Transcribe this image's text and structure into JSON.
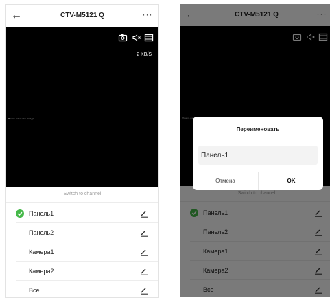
{
  "screen": {
    "back_icon": "arrow-left-icon",
    "title": "CTV-M5121 Q",
    "more_icon": "more-horizontal-icon",
    "more_glyph": "···",
    "video": {
      "icons": [
        "camera-icon",
        "speaker-mute-icon",
        "fullscreen-icon"
      ],
      "bitrate": "2 KB/S",
      "osd_text": "Панель с вызывну. вход пд"
    },
    "sheet": {
      "title": "Switch to channel",
      "channels": [
        {
          "label": "Панель1",
          "selected": true
        },
        {
          "label": "Панель2",
          "selected": false
        },
        {
          "label": "Камера1",
          "selected": false
        },
        {
          "label": "Камера2",
          "selected": false
        },
        {
          "label": "Все",
          "selected": false
        }
      ]
    }
  },
  "rename_dialog": {
    "title": "Переименовать",
    "input_value": "Панель1",
    "cancel_label": "Отмена",
    "ok_label": "OK"
  },
  "colors": {
    "check_green": "#46b94a",
    "video_background": "#000000",
    "overlay": "rgba(0,0,0,0.52)"
  }
}
